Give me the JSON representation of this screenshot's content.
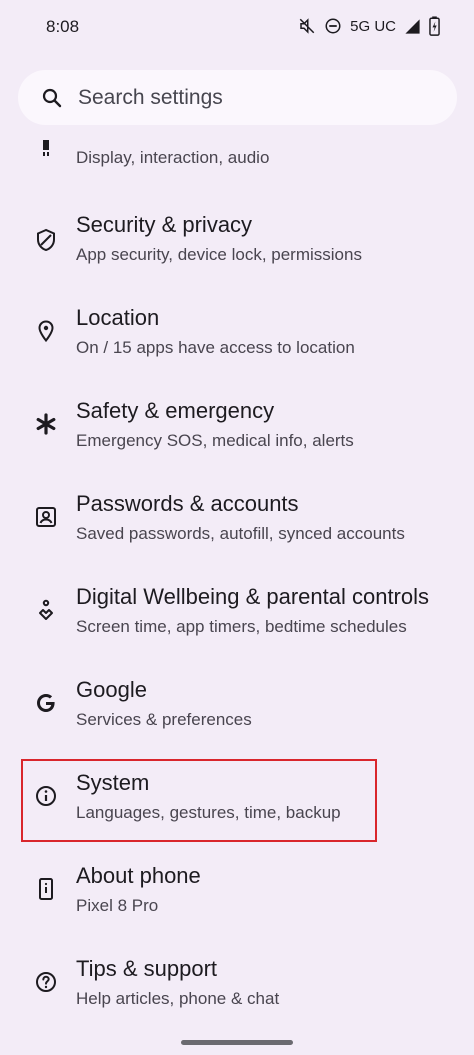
{
  "status_bar": {
    "time": "8:08",
    "network": "5G UC",
    "icons": [
      "mute-icon",
      "do-not-disturb-icon",
      "signal-icon",
      "battery-icon"
    ]
  },
  "search": {
    "placeholder": "Search settings",
    "icon": "search-icon"
  },
  "items": [
    {
      "title": "",
      "subtitle": "Display, interaction, audio",
      "icon": "accessibility-icon"
    },
    {
      "title": "Security & privacy",
      "subtitle": "App security, device lock, permissions",
      "icon": "shield-icon"
    },
    {
      "title": "Location",
      "subtitle": "On / 15 apps have access to location",
      "icon": "location-pin-icon"
    },
    {
      "title": "Safety & emergency",
      "subtitle": "Emergency SOS, medical info, alerts",
      "icon": "asterisk-icon"
    },
    {
      "title": "Passwords & accounts",
      "subtitle": "Saved passwords, autofill, synced accounts",
      "icon": "account-box-icon"
    },
    {
      "title": "Digital Wellbeing & parental controls",
      "subtitle": "Screen time, app timers, bedtime schedules",
      "icon": "wellbeing-icon"
    },
    {
      "title": "Google",
      "subtitle": "Services & preferences",
      "icon": "google-icon"
    },
    {
      "title": "System",
      "subtitle": "Languages, gestures, time, backup",
      "icon": "info-icon"
    },
    {
      "title": "About phone",
      "subtitle": "Pixel 8 Pro",
      "icon": "phone-info-icon"
    },
    {
      "title": "Tips & support",
      "subtitle": "Help articles, phone & chat",
      "icon": "help-icon"
    }
  ],
  "colors": {
    "background": "#f3ecf7",
    "search_background": "#fbf7fd",
    "highlight": "#d9262c"
  }
}
